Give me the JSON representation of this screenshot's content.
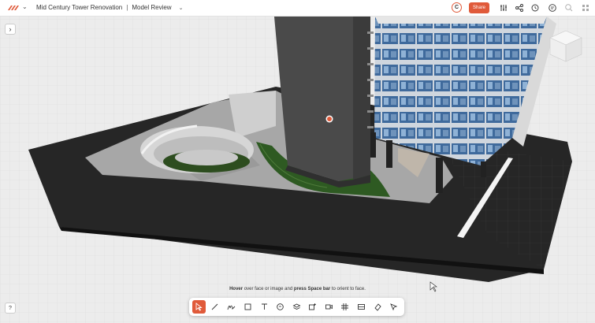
{
  "topbar": {
    "project_name": "Mid Century Tower Renovation",
    "separator": "|",
    "view_name": "Model Review",
    "avatar_initial": "C",
    "share_label": "Share"
  },
  "viewport": {
    "hint_hover": "Hover",
    "hint_mid": "over face or image and",
    "hint_press": "press Space bar",
    "hint_end": "to orient to face."
  },
  "icons": {
    "logo": "app-logo-icon",
    "sidebar_toggle": "chevron-right-icon",
    "help": "help-icon",
    "topbar_right": [
      "sliders-icon",
      "share-network-icon",
      "history-icon",
      "comment-icon",
      "search-icon",
      "grid-menu-icon"
    ],
    "tools": [
      "select-arrow-icon",
      "line-icon",
      "freehand-icon",
      "rectangle-icon",
      "text-icon",
      "comment-icon",
      "layers-icon",
      "add-image-icon",
      "camera-icon",
      "grid-icon",
      "section-icon",
      "eraser-icon",
      "pointer-tool-icon"
    ]
  },
  "colors": {
    "accent": "#e05a3a"
  }
}
